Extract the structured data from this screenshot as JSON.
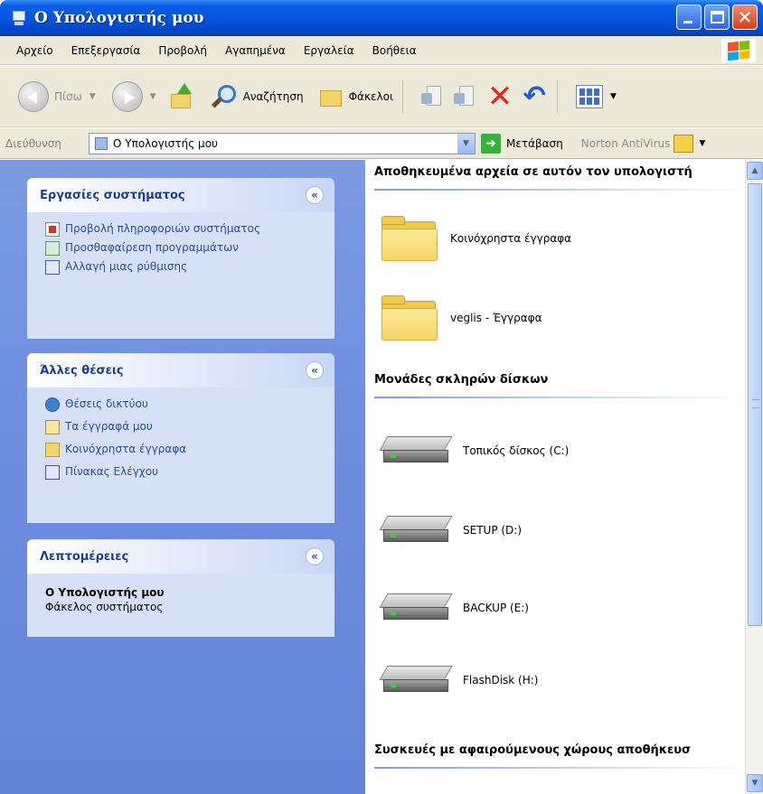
{
  "window": {
    "title": "Ο Υπολογιστής μου"
  },
  "menu": [
    "Αρχείο",
    "Επεξεργασία",
    "Προβολή",
    "Αγαπημένα",
    "Εργαλεία",
    "Βοήθεια"
  ],
  "toolbar": {
    "back_label": "Πίσω",
    "search_label": "Αναζήτηση",
    "folders_label": "Φάκελοι"
  },
  "address": {
    "label": "Διεύθυνση",
    "value": "Ο Υπολογιστής μου",
    "go_label": "Μετάβαση",
    "norton_label": "Norton AntiVirus"
  },
  "left_panels": {
    "system_tasks": {
      "title": "Εργασίες συστήματος",
      "items": [
        "Προβολή πληροφοριών συστήματος",
        "Προσθαφαίρεση προγραμμάτων",
        "Αλλαγή μιας ρύθμισης"
      ]
    },
    "other_places": {
      "title": "Άλλες θέσεις",
      "items": [
        "Θέσεις δικτύου",
        "Τα έγγραφά μου",
        "Κοινόχρηστα έγγραφα",
        "Πίνακας Ελέγχου"
      ]
    },
    "details": {
      "title": "Λεπτομέρειες",
      "name": "Ο Υπολογιστής μου",
      "type": "Φάκελος συστήματος"
    }
  },
  "right": {
    "stored_files_header": "Αποθηκευμένα αρχεία σε αυτόν τον υπολογιστή",
    "folders": [
      "Κοινόχρηστα έγγραφα",
      "veglis - Έγγραφα"
    ],
    "hard_drives_header": "Μονάδες σκληρών δίσκων",
    "drives": [
      "Τοπικός δίσκος (C:)",
      "SETUP (D:)",
      "BACKUP (E:)",
      "FlashDisk (H:)"
    ],
    "removable_header": "Συσκευές με αφαιρούμενους χώρους αποθήκευσ"
  },
  "colors": {
    "titlebar": "#0656de",
    "leftpane": "#6f8ee0",
    "panel_title": "#1e3f8f",
    "task_link": "#2a4f9b"
  }
}
